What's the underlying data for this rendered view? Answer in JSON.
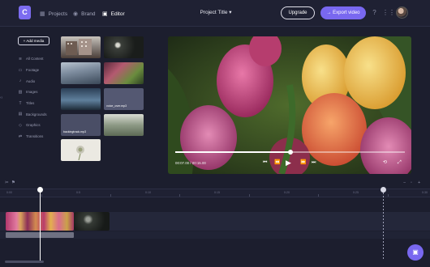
{
  "header": {
    "logo_letter": "C",
    "nav": [
      {
        "label": "Projects",
        "icon": "grid-icon"
      },
      {
        "label": "Brand",
        "icon": "brand-icon"
      },
      {
        "label": "Editor",
        "icon": "film-icon"
      }
    ],
    "project_title": "Project Title ▾",
    "upgrade_label": "Upgrade",
    "export_label": "→ Export video"
  },
  "sidebar": {
    "add_media_label": "+ Add media",
    "items": [
      {
        "label": "All Content",
        "icon": "layers-icon"
      },
      {
        "label": "Footage",
        "icon": "film-icon"
      },
      {
        "label": "Audio",
        "icon": "music-icon"
      },
      {
        "label": "Images",
        "icon": "image-icon"
      },
      {
        "label": "Titles",
        "icon": "text-icon"
      },
      {
        "label": "Backgrounds",
        "icon": "background-icon"
      },
      {
        "label": "Graphics",
        "icon": "shapes-icon"
      },
      {
        "label": "Transitions",
        "icon": "transition-icon"
      }
    ]
  },
  "media": {
    "labels": {
      "t5": "voice_over.mp3",
      "t7": "backingtrack.mp3"
    }
  },
  "preview": {
    "timecode": "00:07.00 / 00:15.00",
    "progress": 0.47
  },
  "timeline": {
    "ruler_labels": [
      "0:00",
      "0:5",
      "0:10",
      "0:15",
      "0:20",
      "0:25",
      "0:30"
    ],
    "playhead_time": "0:1"
  },
  "colors": {
    "accent": "#7968f0",
    "background": "#1c1e2e"
  }
}
